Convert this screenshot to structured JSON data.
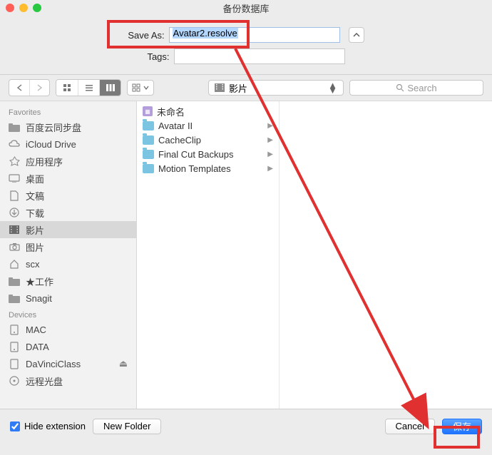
{
  "window": {
    "title": "备份数据库"
  },
  "saveas": {
    "label": "Save As:",
    "value": "Avatar2.resolve"
  },
  "tags": {
    "label": "Tags:"
  },
  "toolbar": {
    "location": {
      "label": "影片"
    },
    "search_placeholder": "Search"
  },
  "sidebar": {
    "favorites_header": "Favorites",
    "favorites": [
      {
        "label": "百度云同步盘",
        "icon": "folder"
      },
      {
        "label": "iCloud Drive",
        "icon": "cloud"
      },
      {
        "label": "应用程序",
        "icon": "apps"
      },
      {
        "label": "桌面",
        "icon": "desktop"
      },
      {
        "label": "文稿",
        "icon": "doc"
      },
      {
        "label": "下载",
        "icon": "download"
      },
      {
        "label": "影片",
        "icon": "movie",
        "active": true
      },
      {
        "label": "图片",
        "icon": "camera"
      },
      {
        "label": "scx",
        "icon": "home"
      },
      {
        "label": "★工作",
        "icon": "folder"
      },
      {
        "label": "Snagit",
        "icon": "folder"
      }
    ],
    "devices_header": "Devices",
    "devices": [
      {
        "label": "MAC",
        "icon": "disk"
      },
      {
        "label": "DATA",
        "icon": "disk"
      },
      {
        "label": "DaVinciClass",
        "icon": "usb",
        "eject": true
      },
      {
        "label": "远程光盘",
        "icon": "cd"
      }
    ]
  },
  "column": {
    "items": [
      {
        "label": "未命名",
        "type": "file"
      },
      {
        "label": "Avatar II",
        "type": "folder",
        "expandable": true
      },
      {
        "label": "CacheClip",
        "type": "folder",
        "expandable": true
      },
      {
        "label": "Final Cut Backups",
        "type": "folder",
        "expandable": true
      },
      {
        "label": "Motion Templates",
        "type": "folder",
        "expandable": true
      }
    ]
  },
  "bottom": {
    "hide_ext": "Hide extension",
    "new_folder": "New Folder",
    "cancel": "Cancel",
    "save": "保存"
  }
}
